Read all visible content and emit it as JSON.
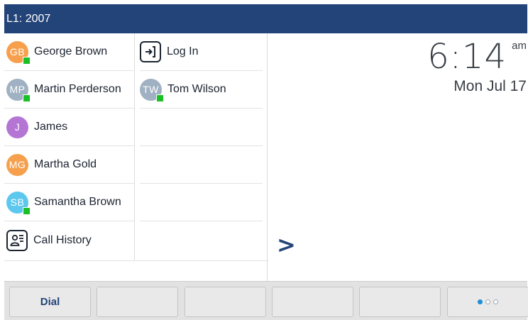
{
  "title_bar": {
    "line_label": "L1: 2007"
  },
  "colors": {
    "title_bar_bg": "#234478",
    "presence_online": "#1bbf26",
    "softkey_text": "#234478",
    "pager_active": "#1e8fd8"
  },
  "column1": [
    {
      "initials": "GB",
      "name": "George Brown",
      "avatar_color": "#f6a04d",
      "presence": true
    },
    {
      "initials": "MP",
      "name": "Martin Perderson",
      "avatar_color": "#9fb1c2",
      "presence": true
    },
    {
      "initials": "J",
      "name": "James",
      "avatar_color": "#b475d5",
      "presence": false
    },
    {
      "initials": "MG",
      "name": "Martha Gold",
      "avatar_color": "#f6a04d",
      "presence": false
    },
    {
      "initials": "SB",
      "name": "Samantha Brown",
      "avatar_color": "#5dc8ee",
      "presence": true
    },
    {
      "icon": "call-history-icon",
      "name": "Call History"
    }
  ],
  "column2": [
    {
      "icon": "login-icon",
      "name": "Log In"
    },
    {
      "initials": "TW",
      "name": "Tom Wilson",
      "avatar_color": "#9fb1c2",
      "presence": true
    }
  ],
  "clock": {
    "time": "6:14",
    "ampm": "am",
    "date": "Mon Jul 17"
  },
  "more_arrow": ">",
  "softkeys": [
    {
      "label": "Dial"
    },
    {
      "label": ""
    },
    {
      "label": ""
    },
    {
      "label": ""
    },
    {
      "label": ""
    }
  ],
  "pager": {
    "pages": 3,
    "current": 1
  }
}
